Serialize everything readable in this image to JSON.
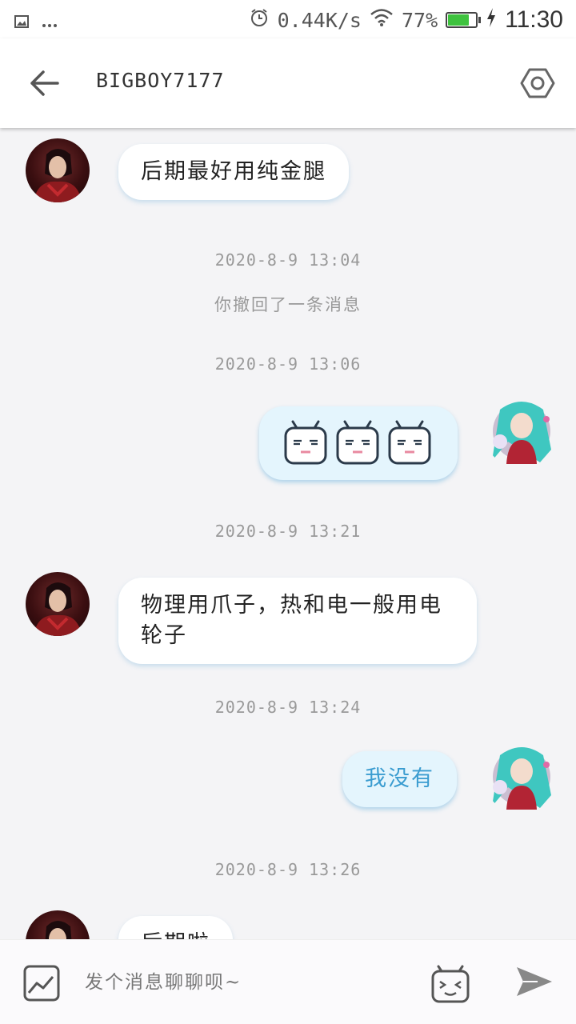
{
  "status_bar": {
    "network_speed": "0.44K/s",
    "battery": "77%",
    "battery_level": 0.77,
    "time": "11:30",
    "icons": [
      "gallery-notification-icon",
      "more-dots-icon",
      "alarm-icon",
      "wifi-icon",
      "battery-icon",
      "charging-icon"
    ]
  },
  "header": {
    "title": "BIGBOY7177",
    "back_icon": "arrow-left-icon",
    "settings_icon": "hexagon-gear-icon"
  },
  "messages": [
    {
      "type": "text",
      "side": "other",
      "text": "后期最好用纯金腿"
    },
    {
      "type": "timestamp",
      "text": "2020-8-9 13:04"
    },
    {
      "type": "notice",
      "text": "你撤回了一条消息"
    },
    {
      "type": "timestamp",
      "text": "2020-8-9 13:06"
    },
    {
      "type": "stickers",
      "side": "me",
      "count": 3,
      "sticker": "bilibili-tv-face"
    },
    {
      "type": "timestamp",
      "text": "2020-8-9 13:21"
    },
    {
      "type": "text",
      "side": "other",
      "text": "物理用爪子，热和电一般用电轮子"
    },
    {
      "type": "timestamp",
      "text": "2020-8-9 13:24"
    },
    {
      "type": "text",
      "side": "me",
      "text": "我没有"
    },
    {
      "type": "timestamp",
      "text": "2020-8-9 13:26"
    },
    {
      "type": "text",
      "side": "other",
      "text": "后期啦"
    }
  ],
  "input_bar": {
    "placeholder": "发个消息聊聊呗~",
    "image_icon": "image-icon",
    "emoji_icon": "bilibili-emoji-icon",
    "send_icon": "send-icon"
  },
  "colors": {
    "my_bubble_text": "#3a9cd0",
    "my_bubble_bg": "#e4f5fd",
    "battery_fill": "#3ec23e"
  }
}
